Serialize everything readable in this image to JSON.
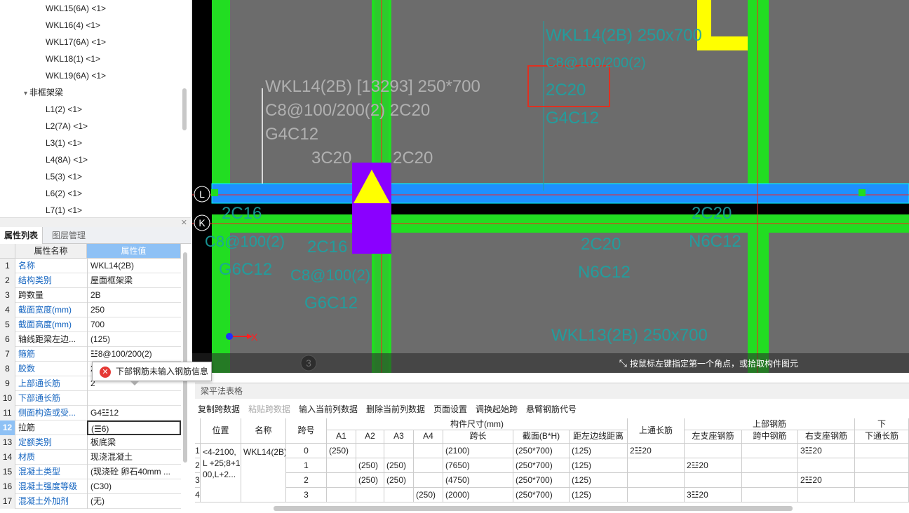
{
  "tree": {
    "items": [
      {
        "label": "WKL15(6A)  <1>",
        "indent": 2
      },
      {
        "label": "WKL16(4)  <1>",
        "indent": 2
      },
      {
        "label": "WKL17(6A)  <1>",
        "indent": 2
      },
      {
        "label": "WKL18(1)  <1>",
        "indent": 2
      },
      {
        "label": "WKL19(6A)  <1>",
        "indent": 2
      },
      {
        "label": "非框架梁",
        "indent": 1,
        "expander": "▾"
      },
      {
        "label": "L1(2)  <1>",
        "indent": 2
      },
      {
        "label": "L2(7A)  <1>",
        "indent": 2
      },
      {
        "label": "L3(1)  <1>",
        "indent": 2
      },
      {
        "label": "L4(8A)  <1>",
        "indent": 2
      },
      {
        "label": "L5(3)  <1>",
        "indent": 2
      },
      {
        "label": "L6(2)  <1>",
        "indent": 2
      },
      {
        "label": "L7(1)  <1>",
        "indent": 2
      }
    ]
  },
  "props": {
    "tabs": [
      "属性列表",
      "图层管理"
    ],
    "header": {
      "name": "属性名称",
      "value": "属性值"
    },
    "rows": [
      {
        "n": "1",
        "name": "名称",
        "value": "WKL14(2B)",
        "blue": true
      },
      {
        "n": "2",
        "name": "结构类别",
        "value": "屋面框架梁",
        "blue": true
      },
      {
        "n": "3",
        "name": "跨数量",
        "value": "2B",
        "blue": false
      },
      {
        "n": "4",
        "name": "截面宽度(mm)",
        "value": "250",
        "blue": true
      },
      {
        "n": "5",
        "name": "截面高度(mm)",
        "value": "700",
        "blue": true
      },
      {
        "n": "6",
        "name": "轴线距梁左边...",
        "value": "(125)",
        "blue": false
      },
      {
        "n": "7",
        "name": "箍筋",
        "value": "☳8@100/200(2)",
        "blue": true
      },
      {
        "n": "8",
        "name": "胶数",
        "value": "2",
        "blue": true
      },
      {
        "n": "9",
        "name": "上部通长筋",
        "value": "2",
        "blue": true
      },
      {
        "n": "10",
        "name": "下部通长筋",
        "value": "",
        "blue": true
      },
      {
        "n": "11",
        "name": "侧面构造或受...",
        "value": "G4☳12",
        "blue": true
      },
      {
        "n": "12",
        "name": "拉筋",
        "value": "(☰6)",
        "blue": false,
        "selected": true
      },
      {
        "n": "13",
        "name": "定额类别",
        "value": "板底梁",
        "blue": true
      },
      {
        "n": "14",
        "name": "材质",
        "value": "现浇混凝土",
        "blue": true
      },
      {
        "n": "15",
        "name": "混凝土类型",
        "value": "(现浇砼 卵石40mm ...",
        "blue": true
      },
      {
        "n": "16",
        "name": "混凝土强度等级",
        "value": "(C30)",
        "blue": true
      },
      {
        "n": "17",
        "name": "混凝土外加剂",
        "value": "(无)",
        "blue": true
      }
    ]
  },
  "tooltip": {
    "text": "下部钢筋未输入钢筋信息",
    "icon": "error-icon"
  },
  "cad": {
    "labels": {
      "beam_name": "WKL14(2B) [13293] 250*700",
      "stirrup": "C8@100/200(2) 2C20",
      "side": "G4C12",
      "left_top": "3C20",
      "right_top": "2C20",
      "right_name": "WKL14(2B) 250x700",
      "right_stirrup": "C8@100/200(2)",
      "right_top_rebar": "2C20",
      "right_side": "G4C12",
      "k_left_1": "2C16",
      "k_left_2": "C8@100(2)",
      "k_left_3": "G6C12",
      "k_mid_1": "2C16",
      "k_mid_2": "C8@100(2)",
      "k_mid_3": "G6C12",
      "k_r1": "2C20",
      "k_r2": "N6C12",
      "k_r3": "2C20",
      "k_r4": "N6C12",
      "bottom_name": "WKL13(2B) 250x700",
      "axis_L": "L",
      "axis_K": "K",
      "axis_3": "3",
      "x_axis": "X",
      "y_axis": "Y"
    },
    "status": "按鼠标左键指定第一个角点，或拾取构件图元"
  },
  "bottom": {
    "title": "梁平法表格",
    "toolbar": [
      "复制跨数据",
      "粘贴跨数据",
      "输入当前列数据",
      "删除当前列数据",
      "页面设置",
      "调换起始跨",
      "悬臂钢筋代号"
    ],
    "headers": {
      "pos": "位置",
      "name": "名称",
      "span": "跨号",
      "dims": "构件尺寸(mm)",
      "a1": "A1",
      "a2": "A2",
      "a3": "A3",
      "a4": "A4",
      "len": "跨长",
      "sect": "截面(B*H)",
      "dist": "距左边线距离",
      "top_cont": "上通长筋",
      "top_rebar": "上部钢筋",
      "left_seat": "左支座钢筋",
      "mid": "跨中钢筋",
      "right_seat": "右支座钢筋",
      "lower": "下",
      "bot_cont": "下通长筋"
    },
    "pos_text": "<4-2100, L +25;8+1 00,L+2...",
    "name_text": "WKL14(2B)",
    "rows": [
      {
        "n": "1",
        "span": "0",
        "a1": "(250)",
        "a2": "",
        "a3": "",
        "a4": "",
        "len": "(2100)",
        "sect": "(250*700)",
        "dist": "(125)",
        "top": "2☳20",
        "left": "",
        "mid": "",
        "right": "3☳20"
      },
      {
        "n": "2",
        "span": "1",
        "a1": "",
        "a2": "(250)",
        "a3": "(250)",
        "a4": "",
        "len": "(7650)",
        "sect": "(250*700)",
        "dist": "(125)",
        "top": "",
        "left": "2☳20",
        "mid": "",
        "right": ""
      },
      {
        "n": "3",
        "span": "2",
        "a1": "",
        "a2": "(250)",
        "a3": "(250)",
        "a4": "",
        "len": "(4750)",
        "sect": "(250*700)",
        "dist": "(125)",
        "top": "",
        "left": "",
        "mid": "",
        "right": "2☳20"
      },
      {
        "n": "4",
        "span": "3",
        "a1": "",
        "a2": "",
        "a3": "",
        "a4": "(250)",
        "len": "(2000)",
        "sect": "(250*700)",
        "dist": "(125)",
        "top": "",
        "left": "3☳20",
        "mid": "",
        "right": ""
      }
    ]
  },
  "colors": {
    "canvas": "#6c6c6c",
    "green": "#22dd22",
    "beam_blue": "#1e90ff",
    "purple": "#8a00ff",
    "yellow": "#ffff00",
    "axis_red": "#ff2020",
    "label_gray": "#b0b0b0",
    "label_teal": "#1aa3a3"
  }
}
